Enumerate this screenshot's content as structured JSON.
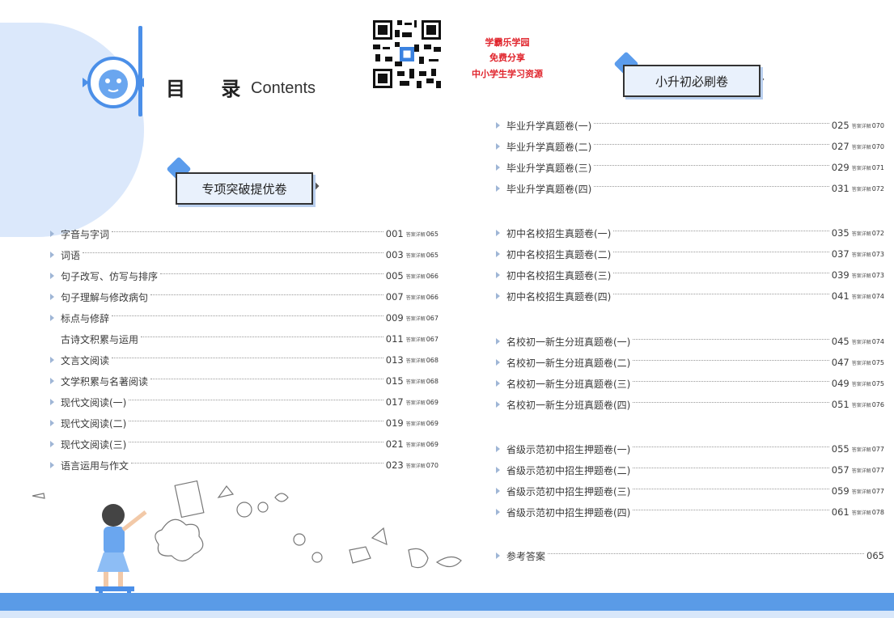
{
  "header": {
    "title": "目 录",
    "title_en": "Contents"
  },
  "promo": {
    "line1": "学霸乐学园",
    "line2": "免费分享",
    "line3": "中小学生学习资源"
  },
  "sections": {
    "left_banner": "专项突破提优卷",
    "right_banner": "小升初必刷卷"
  },
  "answer_label": "答案详解",
  "left_items": [
    {
      "title": "字音与字词",
      "page": "001",
      "answer": "065",
      "bullet": true
    },
    {
      "title": "词语",
      "page": "003",
      "answer": "065",
      "bullet": true
    },
    {
      "title": "句子改写、仿写与排序",
      "page": "005",
      "answer": "066",
      "bullet": true
    },
    {
      "title": "句子理解与修改病句",
      "page": "007",
      "answer": "066",
      "bullet": true
    },
    {
      "title": "标点与修辞",
      "page": "009",
      "answer": "067",
      "bullet": true
    },
    {
      "title": "古诗文积累与运用",
      "page": "011",
      "answer": "067",
      "bullet": false
    },
    {
      "title": "文言文阅读",
      "page": "013",
      "answer": "068",
      "bullet": true
    },
    {
      "title": "文学积累与名著阅读",
      "page": "015",
      "answer": "068",
      "bullet": true
    },
    {
      "title": "现代文阅读(一)",
      "page": "017",
      "answer": "069",
      "bullet": true
    },
    {
      "title": "现代文阅读(二)",
      "page": "019",
      "answer": "069",
      "bullet": true
    },
    {
      "title": "现代文阅读(三)",
      "page": "021",
      "answer": "069",
      "bullet": true
    },
    {
      "title": "语言运用与作文",
      "page": "023",
      "answer": "070",
      "bullet": true
    }
  ],
  "right_group_1": [
    {
      "title": "毕业升学真题卷(一)",
      "page": "025",
      "answer": "070"
    },
    {
      "title": "毕业升学真题卷(二)",
      "page": "027",
      "answer": "070"
    },
    {
      "title": "毕业升学真题卷(三)",
      "page": "029",
      "answer": "071"
    },
    {
      "title": "毕业升学真题卷(四)",
      "page": "031",
      "answer": "072"
    }
  ],
  "right_group_2": [
    {
      "title": "初中名校招生真题卷(一)",
      "page": "035",
      "answer": "072"
    },
    {
      "title": "初中名校招生真题卷(二)",
      "page": "037",
      "answer": "073"
    },
    {
      "title": "初中名校招生真题卷(三)",
      "page": "039",
      "answer": "073"
    },
    {
      "title": "初中名校招生真题卷(四)",
      "page": "041",
      "answer": "074"
    }
  ],
  "right_group_3": [
    {
      "title": "名校初一新生分班真题卷(一)",
      "page": "045",
      "answer": "074"
    },
    {
      "title": "名校初一新生分班真题卷(二)",
      "page": "047",
      "answer": "075"
    },
    {
      "title": "名校初一新生分班真题卷(三)",
      "page": "049",
      "answer": "075"
    },
    {
      "title": "名校初一新生分班真题卷(四)",
      "page": "051",
      "answer": "076"
    }
  ],
  "right_group_4": [
    {
      "title": "省级示范初中招生押题卷(一)",
      "page": "055",
      "answer": "077"
    },
    {
      "title": "省级示范初中招生押题卷(二)",
      "page": "057",
      "answer": "077"
    },
    {
      "title": "省级示范初中招生押题卷(三)",
      "page": "059",
      "answer": "077"
    },
    {
      "title": "省级示范初中招生押题卷(四)",
      "page": "061",
      "answer": "078"
    }
  ],
  "answers_item": {
    "title": "参考答案",
    "page": "065"
  },
  "colors": {
    "accent": "#4b8fe8",
    "promo": "#e0242c",
    "band": "#5a9be7"
  }
}
